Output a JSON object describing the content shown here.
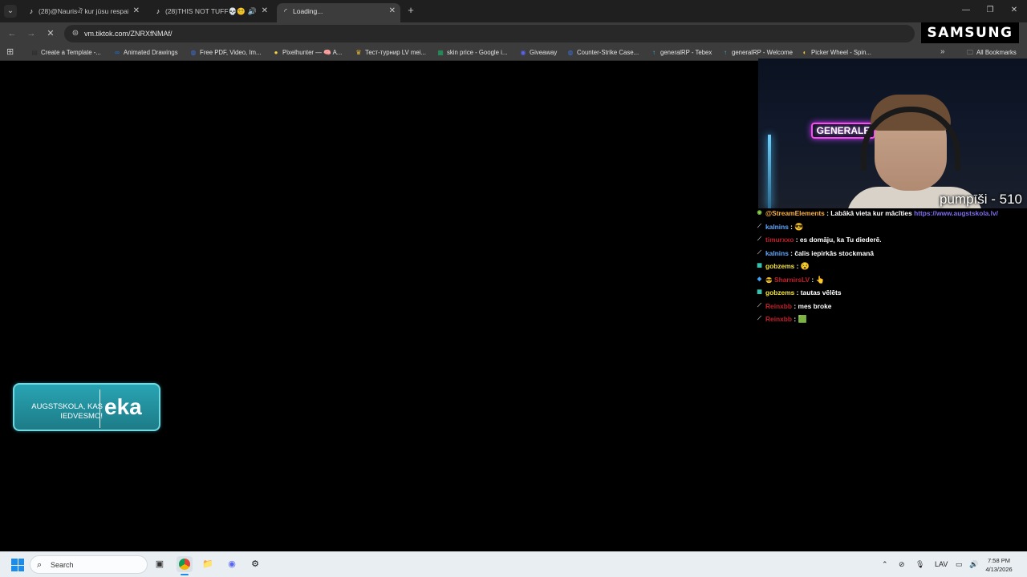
{
  "tabs": [
    {
      "title": "(28)@Naurisঐ kur jūsu respai",
      "favicon": "tiktok-icon",
      "active": false,
      "audio": false
    },
    {
      "title": "(28)THIS NOT TUFF💀😵‍💫💔😭",
      "favicon": "tiktok-icon",
      "active": false,
      "audio": true
    },
    {
      "title": "Loading...",
      "favicon": "loading-icon",
      "active": true,
      "audio": false
    }
  ],
  "address_bar": {
    "url": "vm.tiktok.com/ZNRXfNMAf/"
  },
  "brand_overlay": "SAMSUNG",
  "bookmarks": [
    {
      "label": "Create a Template -...",
      "icon": "template-icon",
      "color": "#2b2b2b"
    },
    {
      "label": "Animated Drawings",
      "icon": "meta-icon",
      "color": "#1877f2"
    },
    {
      "label": "Free PDF, Video, Im...",
      "icon": "globe-icon",
      "color": "#3b6fd8"
    },
    {
      "label": "Pixelhunter — 🧠 A...",
      "icon": "pixelhunter-icon",
      "color": "#f2d23c"
    },
    {
      "label": "Тест-турнир LV mei...",
      "icon": "crown-icon",
      "color": "#e8b92c"
    },
    {
      "label": "skin price - Google i...",
      "icon": "sheets-icon",
      "color": "#1ea362"
    },
    {
      "label": "Giveaway",
      "icon": "discord-icon",
      "color": "#5865f2"
    },
    {
      "label": "Counter-Strike Case...",
      "icon": "globe-icon",
      "color": "#3b6fd8"
    },
    {
      "label": "generalRP - Tebex",
      "icon": "arrow-up-icon",
      "color": "#3fb6d8"
    },
    {
      "label": "generalRP - Welcome",
      "icon": "arrow-up-icon",
      "color": "#3fb6d8"
    },
    {
      "label": "Picker Wheel - Spin...",
      "icon": "wheel-icon",
      "color": "#f2c12e"
    }
  ],
  "all_bookmarks_label": "All Bookmarks",
  "stream": {
    "neon_sign": "GENERALE",
    "overlay_text": "pumpīši - 510"
  },
  "chat": [
    {
      "user": "@StreamElements",
      "color": "#ffb13b",
      "message": "Labākā vieta kur mācīties ",
      "link": "https://www.augstskola.lv/",
      "badge": "verified-badge-icon",
      "emote": ""
    },
    {
      "user": "kalnins",
      "color": "#5fa8ff",
      "message": "",
      "badge": "sword-badge-icon",
      "emote": "😎"
    },
    {
      "user": "timurxxo",
      "color": "#c2202a",
      "message": "es domāju, ka Tu diederē.",
      "badge": "sword-badge-icon",
      "emote": ""
    },
    {
      "user": "kalnins",
      "color": "#5fa8ff",
      "message": "čalis iepirkās stockmanā",
      "badge": "sword-badge-icon",
      "emote": ""
    },
    {
      "user": "gobzems",
      "color": "#f2e23a",
      "message": "",
      "badge": "grid-badge-icon",
      "emote": "😵"
    },
    {
      "user": "SharnirsLV",
      "color": "#c2202a",
      "message": "",
      "badge": "gem-badge-icon",
      "emote": "👆"
    },
    {
      "user": "gobzems",
      "color": "#f2e23a",
      "message": "tautas vēlēts",
      "badge": "grid-badge-icon",
      "emote": ""
    },
    {
      "user": "Reinxbb",
      "color": "#c2202a",
      "message": "mes broke",
      "badge": "sword-badge-icon",
      "emote": ""
    },
    {
      "user": "Reinxbb",
      "color": "#c2202a",
      "message": "",
      "badge": "sword-badge-icon",
      "emote": "🟩"
    }
  ],
  "ad": {
    "tagline": "AUGSTSKOLA, KAS IEDVESMO!",
    "logo": "eka"
  },
  "taskbar": {
    "search_placeholder": "Search",
    "language": "LAV",
    "time": "7:58 PM",
    "date": "4/13/2026"
  }
}
